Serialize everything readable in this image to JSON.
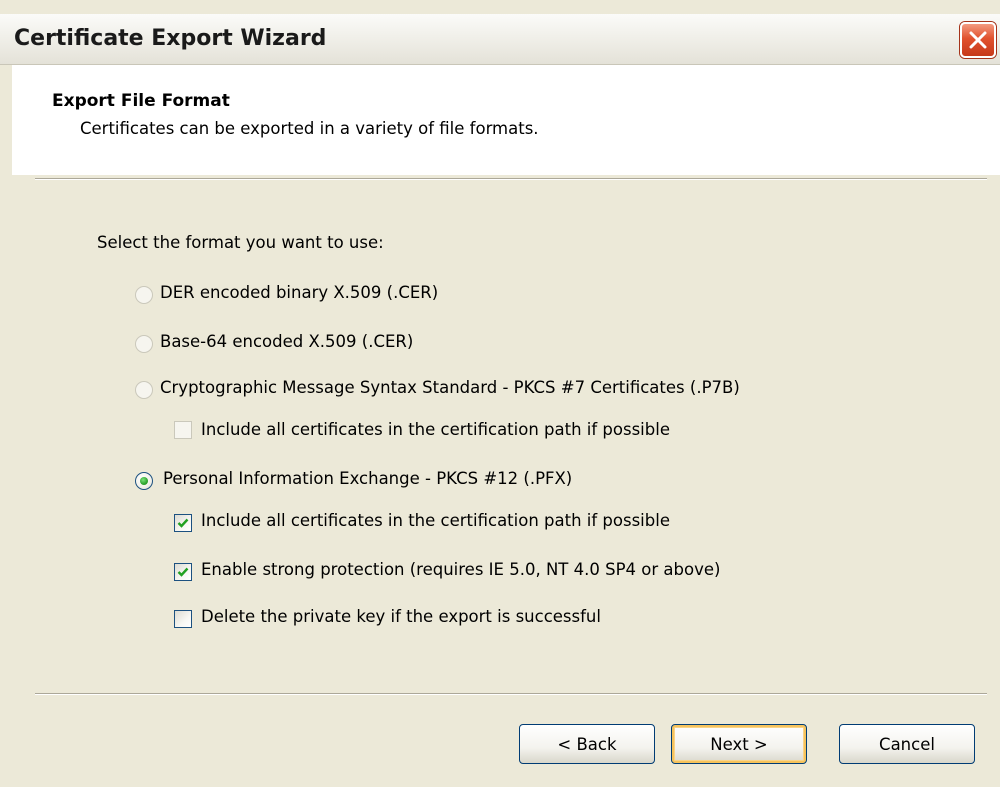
{
  "window": {
    "title": "Certificate Export Wizard"
  },
  "header": {
    "title": "Export File Format",
    "subtitle": "Certificates can be exported in a variety of file formats."
  },
  "body": {
    "prompt": "Select the format you want to use:",
    "options": [
      {
        "label": "DER encoded binary X.509 (.CER)",
        "selected": false,
        "enabled": false
      },
      {
        "label": "Base-64 encoded X.509 (.CER)",
        "selected": false,
        "enabled": false
      },
      {
        "label": "Cryptographic Message Syntax Standard - PKCS #7 Certificates (.P7B)",
        "selected": false,
        "enabled": false
      },
      {
        "label": "Personal Information Exchange - PKCS #12 (.PFX)",
        "selected": true,
        "enabled": true
      }
    ],
    "pkcs7_include_all": {
      "label": "Include all certificates in the certification path if possible",
      "checked": false,
      "enabled": false
    },
    "pfx_include_all": {
      "label": "Include all certificates in the certification path if possible",
      "checked": true,
      "enabled": true
    },
    "pfx_strong_protection": {
      "label": "Enable strong protection (requires IE 5.0, NT 4.0 SP4 or above)",
      "checked": true,
      "enabled": true
    },
    "pfx_delete_key": {
      "label": "Delete the private key if the export is successful",
      "checked": false,
      "enabled": true
    }
  },
  "footer": {
    "back_label": "< Back",
    "next_label": "Next >",
    "cancel_label": "Cancel"
  },
  "colors": {
    "face": "#ece9d8",
    "disabled_text": "#aca899",
    "close_button": "#e1522e",
    "check_mark": "#21a121"
  }
}
